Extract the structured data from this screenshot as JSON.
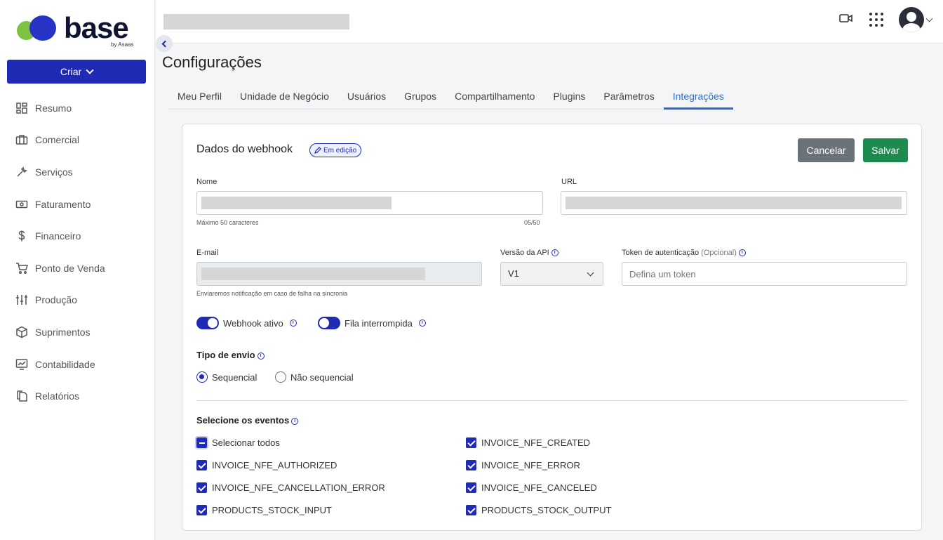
{
  "logo": {
    "word": "base",
    "by": "by Asaas"
  },
  "sidebar": {
    "create_label": "Criar",
    "items": [
      {
        "label": "Resumo",
        "icon": "dashboard-icon"
      },
      {
        "label": "Comercial",
        "icon": "briefcase-icon"
      },
      {
        "label": "Serviços",
        "icon": "wrench-icon"
      },
      {
        "label": "Faturamento",
        "icon": "banknote-icon"
      },
      {
        "label": "Financeiro",
        "icon": "dollar-icon"
      },
      {
        "label": "Ponto de Venda",
        "icon": "cart-icon"
      },
      {
        "label": "Produção",
        "icon": "sliders-icon"
      },
      {
        "label": "Suprimentos",
        "icon": "box-icon"
      },
      {
        "label": "Contabilidade",
        "icon": "chart-monitor-icon"
      },
      {
        "label": "Relatórios",
        "icon": "documents-icon"
      }
    ]
  },
  "page": {
    "title": "Configurações"
  },
  "tabs": [
    "Meu Perfil",
    "Unidade de Negócio",
    "Usuários",
    "Grupos",
    "Compartilhamento",
    "Plugins",
    "Parâmetros",
    "Integrações"
  ],
  "active_tab": "Integrações",
  "card": {
    "title": "Dados do webhook",
    "badge": "Em edição",
    "cancel_label": "Cancelar",
    "save_label": "Salvar"
  },
  "form": {
    "nome_label": "Nome",
    "nome_hint": "Máximo 50 caracteres",
    "nome_count": "05/50",
    "url_label": "URL",
    "email_label": "E-mail",
    "email_hint": "Enviaremos notificação em caso de falha na sincronia",
    "api_label": "Versão da API",
    "api_value": "V1",
    "token_label": "Token de autenticação",
    "token_optional": "(Opcional)",
    "token_placeholder": "Defina um token"
  },
  "toggles": {
    "webhook_ativo": {
      "label": "Webhook ativo",
      "on": true
    },
    "fila_interrompida": {
      "label": "Fila interrompida",
      "on": false
    }
  },
  "envio": {
    "title": "Tipo de envio",
    "options": [
      "Sequencial",
      "Não sequencial"
    ],
    "selected": "Sequencial"
  },
  "eventos": {
    "title": "Selecione os eventos",
    "select_all": "Selecionar todos",
    "left": [
      "INVOICE_NFE_AUTHORIZED",
      "INVOICE_NFE_CANCELLATION_ERROR",
      "PRODUCTS_STOCK_INPUT"
    ],
    "right": [
      "INVOICE_NFE_CREATED",
      "INVOICE_NFE_ERROR",
      "INVOICE_NFE_CANCELED",
      "PRODUCTS_STOCK_OUTPUT"
    ]
  },
  "colors": {
    "primary": "#1f2bb5",
    "success": "#1d8a4e",
    "link": "#2a6fd1",
    "logo_green": "#7dc243"
  }
}
